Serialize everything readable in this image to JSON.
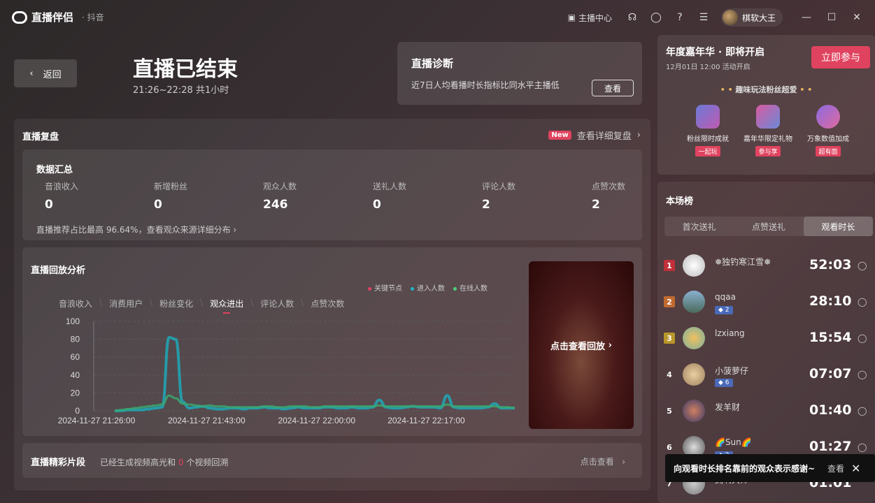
{
  "app": {
    "name": "直播伴侣",
    "sub": "· 抖音"
  },
  "topbar": {
    "anchor_center": "主播中心",
    "username": "棋软大王"
  },
  "header": {
    "back": "返回",
    "title": "直播已结束",
    "time": "21:26~22:28 共1小时"
  },
  "diagnosis": {
    "title": "直播诊断",
    "desc": "近7日人均看播时长指标比同水平主播低",
    "button": "查看"
  },
  "review": {
    "title": "直播复盘",
    "new_badge": "New",
    "link": "查看详细复盘"
  },
  "summary": {
    "title": "数据汇总",
    "stats": [
      {
        "label": "音浪收入",
        "value": "0"
      },
      {
        "label": "新增粉丝",
        "value": "0"
      },
      {
        "label": "观众人数",
        "value": "246"
      },
      {
        "label": "送礼人数",
        "value": "0"
      },
      {
        "label": "评论人数",
        "value": "2"
      },
      {
        "label": "点赞次数",
        "value": "2"
      }
    ],
    "footer": "直播推荐占比最高 96.64%，查看观众来源详细分布"
  },
  "analysis": {
    "title": "直播回放分析",
    "legend": [
      {
        "name": "关键节点",
        "color": "#e0435f"
      },
      {
        "name": "进入人数",
        "color": "#1fb6c8"
      },
      {
        "name": "在线人数",
        "color": "#4ccf7a"
      }
    ],
    "tabs": [
      "音浪收入",
      "消费用户",
      "粉丝变化",
      "观众进出",
      "评论人数",
      "点赞次数"
    ],
    "active_tab": "观众进出",
    "replay_label": "点击查看回放"
  },
  "chart_data": {
    "type": "line",
    "ylim": [
      0,
      100
    ],
    "yticks": [
      "100",
      "80",
      "60",
      "40",
      "20",
      "0"
    ],
    "xticks": [
      "2024-11-27 21:26:00",
      "2024-11-27 21:43:00",
      "2024-11-27 22:00:00",
      "2024-11-27 22:17:00"
    ],
    "series": [
      {
        "name": "进入人数",
        "color": "#1fa8b8",
        "values": [
          0,
          0,
          1,
          1,
          1,
          2,
          3,
          4,
          82,
          80,
          10,
          3,
          4,
          5,
          3,
          2,
          2,
          3,
          3,
          2,
          3,
          3,
          4,
          3,
          3,
          2,
          3,
          4,
          3,
          3,
          3,
          4,
          4,
          3,
          3,
          4,
          3,
          3,
          4,
          12,
          4,
          3,
          3,
          4,
          5,
          4,
          4,
          4,
          3,
          17,
          4,
          3,
          3,
          3,
          3,
          4,
          8,
          3,
          3,
          3,
          2
        ]
      },
      {
        "name": "在线人数",
        "color": "#3aa870",
        "values": [
          0,
          1,
          2,
          3,
          4,
          5,
          6,
          7,
          17,
          14,
          8,
          7,
          6,
          5,
          6,
          5,
          5,
          4,
          4,
          4,
          4,
          4,
          5,
          5,
          4,
          4,
          5,
          5,
          5,
          4,
          4,
          5,
          5,
          5,
          5,
          5,
          5,
          5,
          5,
          6,
          5,
          5,
          5,
          5,
          5,
          5,
          5,
          5,
          5,
          7,
          5,
          5,
          5,
          5,
          5,
          5,
          5,
          4,
          4,
          3,
          2
        ]
      }
    ]
  },
  "clips": {
    "title": "直播精彩片段",
    "desc_a": "已经生成视频高光和",
    "count": "0",
    "desc_b": "个视频回溯",
    "link": "点击查看"
  },
  "carnival": {
    "title": "年度嘉年华 · 即将开启",
    "time": "12月01日 12:00 活动开启",
    "button": "立即参与",
    "subtitle": "趣味玩法粉丝超爱",
    "gifts": [
      {
        "name": "粉丝限时成就",
        "tag": "一起玩"
      },
      {
        "name": "嘉年华限定礼物",
        "tag": "参与享"
      },
      {
        "name": "万象数值加成",
        "tag": "超有面"
      }
    ]
  },
  "ranking": {
    "title": "本场榜",
    "tabs": [
      "首次送礼",
      "点赞送礼",
      "观看时长"
    ],
    "active_tab": "观看时长",
    "items": [
      {
        "rank": "1",
        "name": "❅独钓寒江雪❅",
        "badge": "",
        "time": "52:03"
      },
      {
        "rank": "2",
        "name": "qqaa",
        "badge": "◆ 2",
        "time": "28:10"
      },
      {
        "rank": "3",
        "name": "lzxiang",
        "badge": "",
        "time": "15:54"
      },
      {
        "rank": "4",
        "name": "小菠萝仔",
        "badge": "◆ 6",
        "time": "07:07"
      },
      {
        "rank": "5",
        "name": "发羊财",
        "badge": "",
        "time": "01:40"
      },
      {
        "rank": "6",
        "name": "🌈Sun🌈",
        "badge": "◆ 2",
        "time": "01:27"
      },
      {
        "rank": "7",
        "name": "拥啊大师",
        "badge": "",
        "time": "01:01"
      }
    ]
  },
  "toast": {
    "text": "向观看时长排名靠前的观众表示感谢~",
    "view": "查看"
  }
}
